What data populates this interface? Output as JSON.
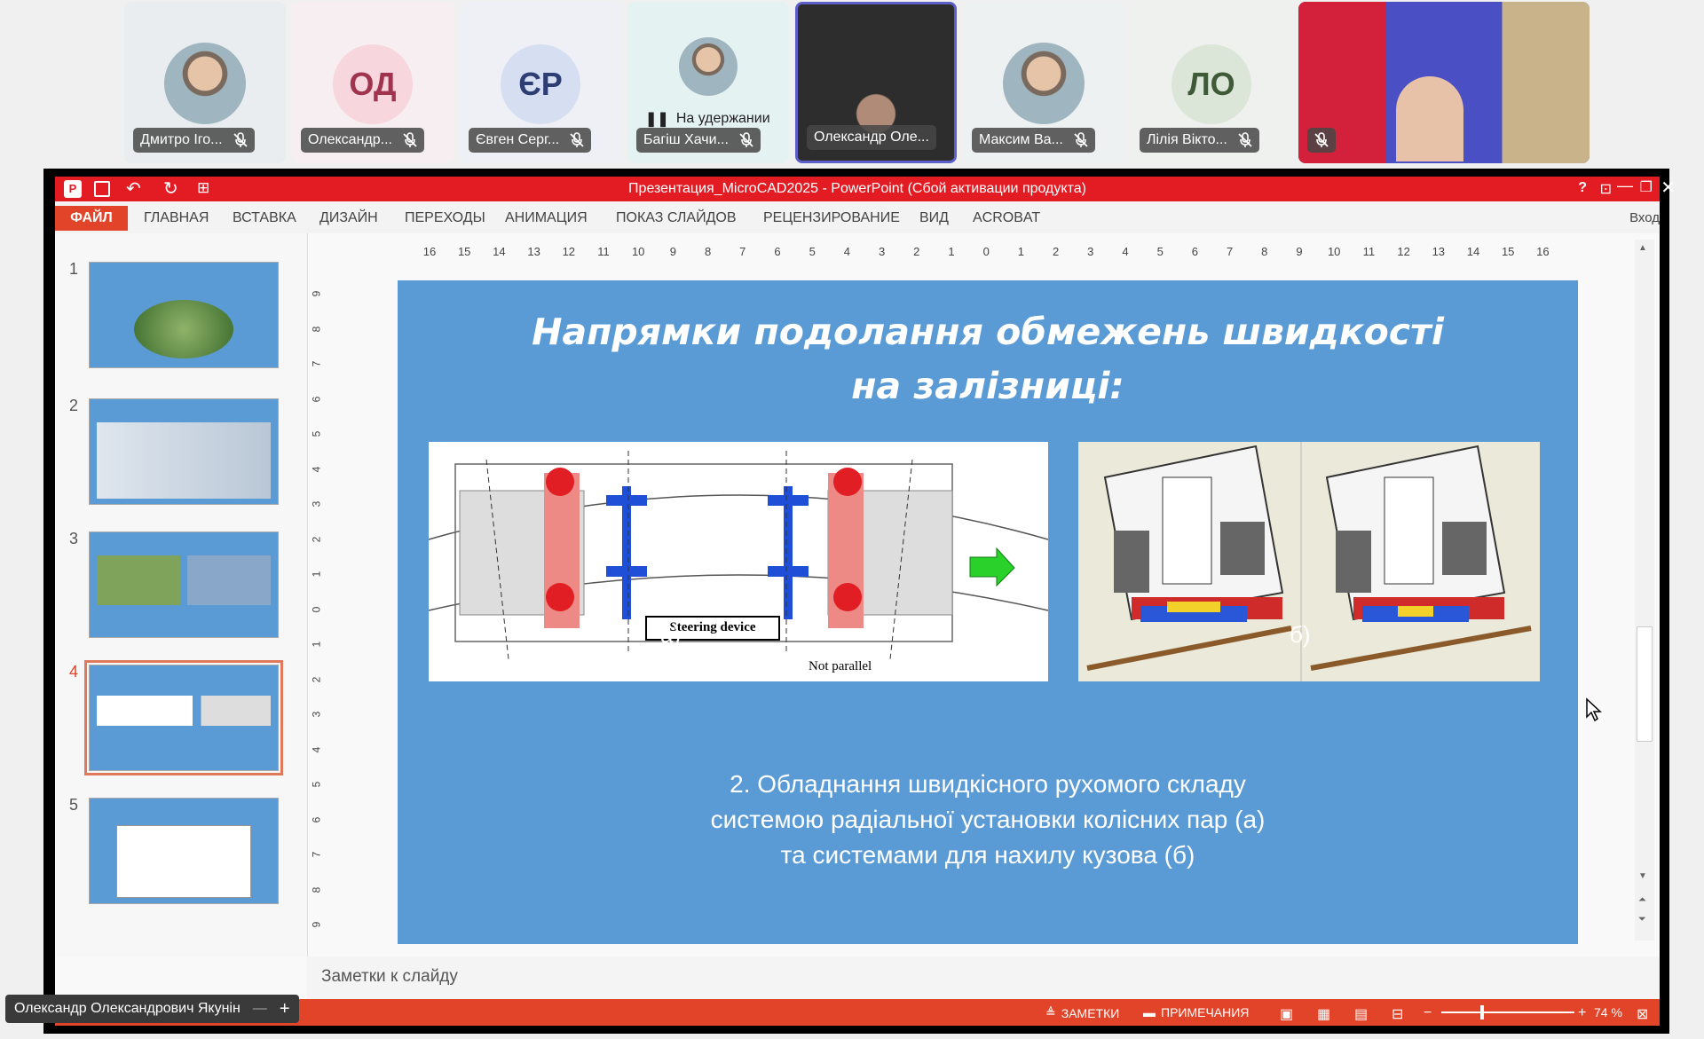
{
  "participants": [
    {
      "name": "Дмитро Іго...",
      "initials": "",
      "kind": "photo",
      "muted": true,
      "bg": "#e9edf0"
    },
    {
      "name": "Олександр...",
      "initials": "ОД",
      "kind": "initials",
      "muted": true,
      "bg": "#f6eef0",
      "circle": "#f7d6de",
      "color": "#a0344f"
    },
    {
      "name": "Євген Серг...",
      "initials": "ЄР",
      "kind": "initials",
      "muted": true,
      "bg": "#eef0f5",
      "circle": "#d6dff1",
      "color": "#2d3e74"
    },
    {
      "name": "Багіш Хачи...",
      "initials": "",
      "kind": "photo",
      "muted": true,
      "bg": "#e5f2f2",
      "hold": "На удержании"
    },
    {
      "name": "Олександр Оле...",
      "initials": "",
      "kind": "video",
      "muted": false,
      "bg": "#2a2a2a",
      "active": true
    },
    {
      "name": "Максим Ва...",
      "initials": "",
      "kind": "photo",
      "muted": true,
      "bg": "#eef1f2"
    },
    {
      "name": "Лілія Вікто...",
      "initials": "ЛО",
      "kind": "initials",
      "muted": true,
      "bg": "#eef1ee",
      "circle": "#dbe6d9",
      "color": "#3e5a36"
    },
    {
      "name": "",
      "initials": "",
      "kind": "video",
      "muted": true,
      "bg": "#4a4fc4"
    }
  ],
  "window": {
    "title": "Презентация_MicroCAD2025 -  PowerPoint (Сбой активации продукта)",
    "help": "?",
    "signin": "Вход"
  },
  "ribbon": {
    "file": "ФАЙЛ",
    "tabs": [
      "ГЛАВНАЯ",
      "ВСТАВКА",
      "ДИЗАЙН",
      "ПЕРЕХОДЫ",
      "АНИМАЦИЯ",
      "ПОКАЗ СЛАЙДОВ",
      "РЕЦЕНЗИРОВАНИЕ",
      "ВИД",
      "ACROBAT"
    ]
  },
  "ruler": {
    "h_ticks": [
      "16",
      "15",
      "14",
      "13",
      "12",
      "11",
      "10",
      "9",
      "8",
      "7",
      "6",
      "5",
      "4",
      "3",
      "2",
      "1",
      "0",
      "1",
      "2",
      "3",
      "4",
      "5",
      "6",
      "7",
      "8",
      "9",
      "10",
      "11",
      "12",
      "13",
      "14",
      "15",
      "16"
    ],
    "v_ticks": [
      "9",
      "8",
      "7",
      "6",
      "5",
      "4",
      "3",
      "2",
      "1",
      "0",
      "1",
      "2",
      "3",
      "4",
      "5",
      "6",
      "7",
      "8",
      "9"
    ]
  },
  "thumbnails": [
    {
      "num": "1",
      "active": false
    },
    {
      "num": "2",
      "active": false
    },
    {
      "num": "3",
      "active": false
    },
    {
      "num": "4",
      "active": true
    },
    {
      "num": "5",
      "active": false
    }
  ],
  "slide": {
    "title_line1": "Напрямки подолання обмежень швидкості",
    "title_line2": "на залізниці:",
    "fig_a_label": "Steering device",
    "fig_a_label2": "Not parallel",
    "caption_a": "а)",
    "caption_b": "б)",
    "body_line1": "2. Обладнання швидкісного рухомого складу",
    "body_line2": "системою радіальної установки колісних пар (а)",
    "body_line3": "та системами для нахилу кузова (б)"
  },
  "notes": {
    "placeholder": "Заметки к слайду"
  },
  "status": {
    "notes": "ЗАМЕТКИ",
    "comments": "ПРИМЕЧАНИЯ",
    "zoom": "74 %"
  },
  "presenter": {
    "name": "Олександр Олександрович Якунін"
  },
  "colors": {
    "accent": "#e2442a",
    "title_red": "#e31b23",
    "slide_bg": "#5b9bd5"
  }
}
